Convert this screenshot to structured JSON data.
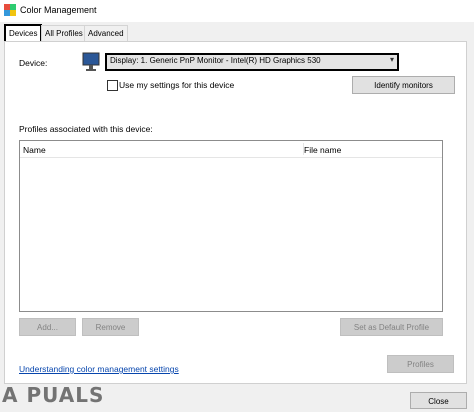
{
  "window": {
    "title": "Color Management"
  },
  "tabs": [
    {
      "label": "Devices"
    },
    {
      "label": "All Profiles"
    },
    {
      "label": "Advanced"
    }
  ],
  "devices": {
    "device_label": "Device:",
    "device_value": "Display: 1. Generic PnP Monitor - Intel(R) HD Graphics 530",
    "use_settings_label": "Use my settings for this device",
    "use_settings_checked": false,
    "identify_button": "Identify monitors",
    "profiles_label": "Profiles associated with this device:",
    "columns": [
      "Name",
      "File name"
    ],
    "add_button": "Add...",
    "remove_button": "Remove",
    "set_default_button": "Set as Default Profile",
    "link_text": "Understanding color management settings",
    "profiles_button": "Profiles",
    "close_button": "Close"
  },
  "watermark": "A  PUALS"
}
